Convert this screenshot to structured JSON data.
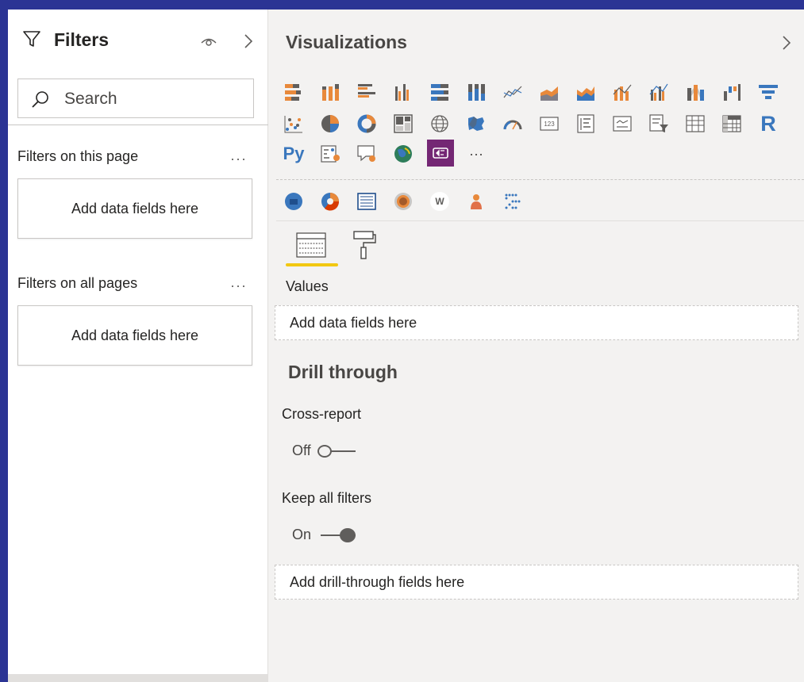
{
  "filters": {
    "title": "Filters",
    "search_placeholder": "Search",
    "this_page_label": "Filters on this page",
    "all_pages_label": "Filters on all pages",
    "more_label": "···",
    "drop_label": "Add data fields here"
  },
  "visualizations": {
    "title": "Visualizations",
    "icons_row1": [
      "stacked-bar-chart-icon",
      "stacked-column-chart-icon",
      "clustered-bar-chart-icon",
      "clustered-column-chart-icon",
      "100-stacked-bar-chart-icon",
      "100-stacked-column-chart-icon",
      "line-chart-icon",
      "area-chart-icon",
      "stacked-area-chart-icon",
      "line-and-stacked-column-chart-icon",
      "line-and-clustered-column-chart-icon",
      "ribbon-chart-icon",
      "waterfall-chart-icon",
      "funnel-chart-icon"
    ],
    "icons_row2": [
      "scatter-chart-icon",
      "pie-chart-icon",
      "donut-chart-icon",
      "treemap-icon",
      "map-icon",
      "filled-map-icon",
      "gauge-icon",
      "card-icon",
      "multi-row-card-icon",
      "kpi-icon",
      "slicer-icon",
      "table-icon",
      "matrix-icon",
      "r-visual-icon"
    ],
    "icons_row3": [
      "python-visual-icon",
      "key-influencers-icon",
      "qa-icon",
      "arcgis-map-icon",
      "power-apps-icon",
      "more-visuals-icon"
    ],
    "r_label": "R",
    "py_label": "Py",
    "more_label": "···",
    "custom_icons": [
      "custom-visual-blue-icon",
      "custom-visual-orange-icon",
      "custom-visual-grid-icon",
      "custom-visual-ring-icon",
      "word-cloud-icon",
      "custom-visual-person-icon",
      "custom-visual-dots-icon"
    ],
    "word_cloud_label": "W",
    "values_label": "Values",
    "values_drop": "Add data fields here",
    "drill_heading": "Drill through",
    "cross_report_label": "Cross-report",
    "cross_report_state": "Off",
    "keep_filters_label": "Keep all filters",
    "keep_filters_state": "On",
    "drill_drop": "Add drill-through fields here"
  },
  "colors": {
    "frame": "#2b3494",
    "accent_yellow": "#f2c811",
    "icon_orange": "#e8893b",
    "icon_blue": "#3a77bd",
    "icon_gray": "#605e5c",
    "power_apps_purple": "#742774"
  }
}
